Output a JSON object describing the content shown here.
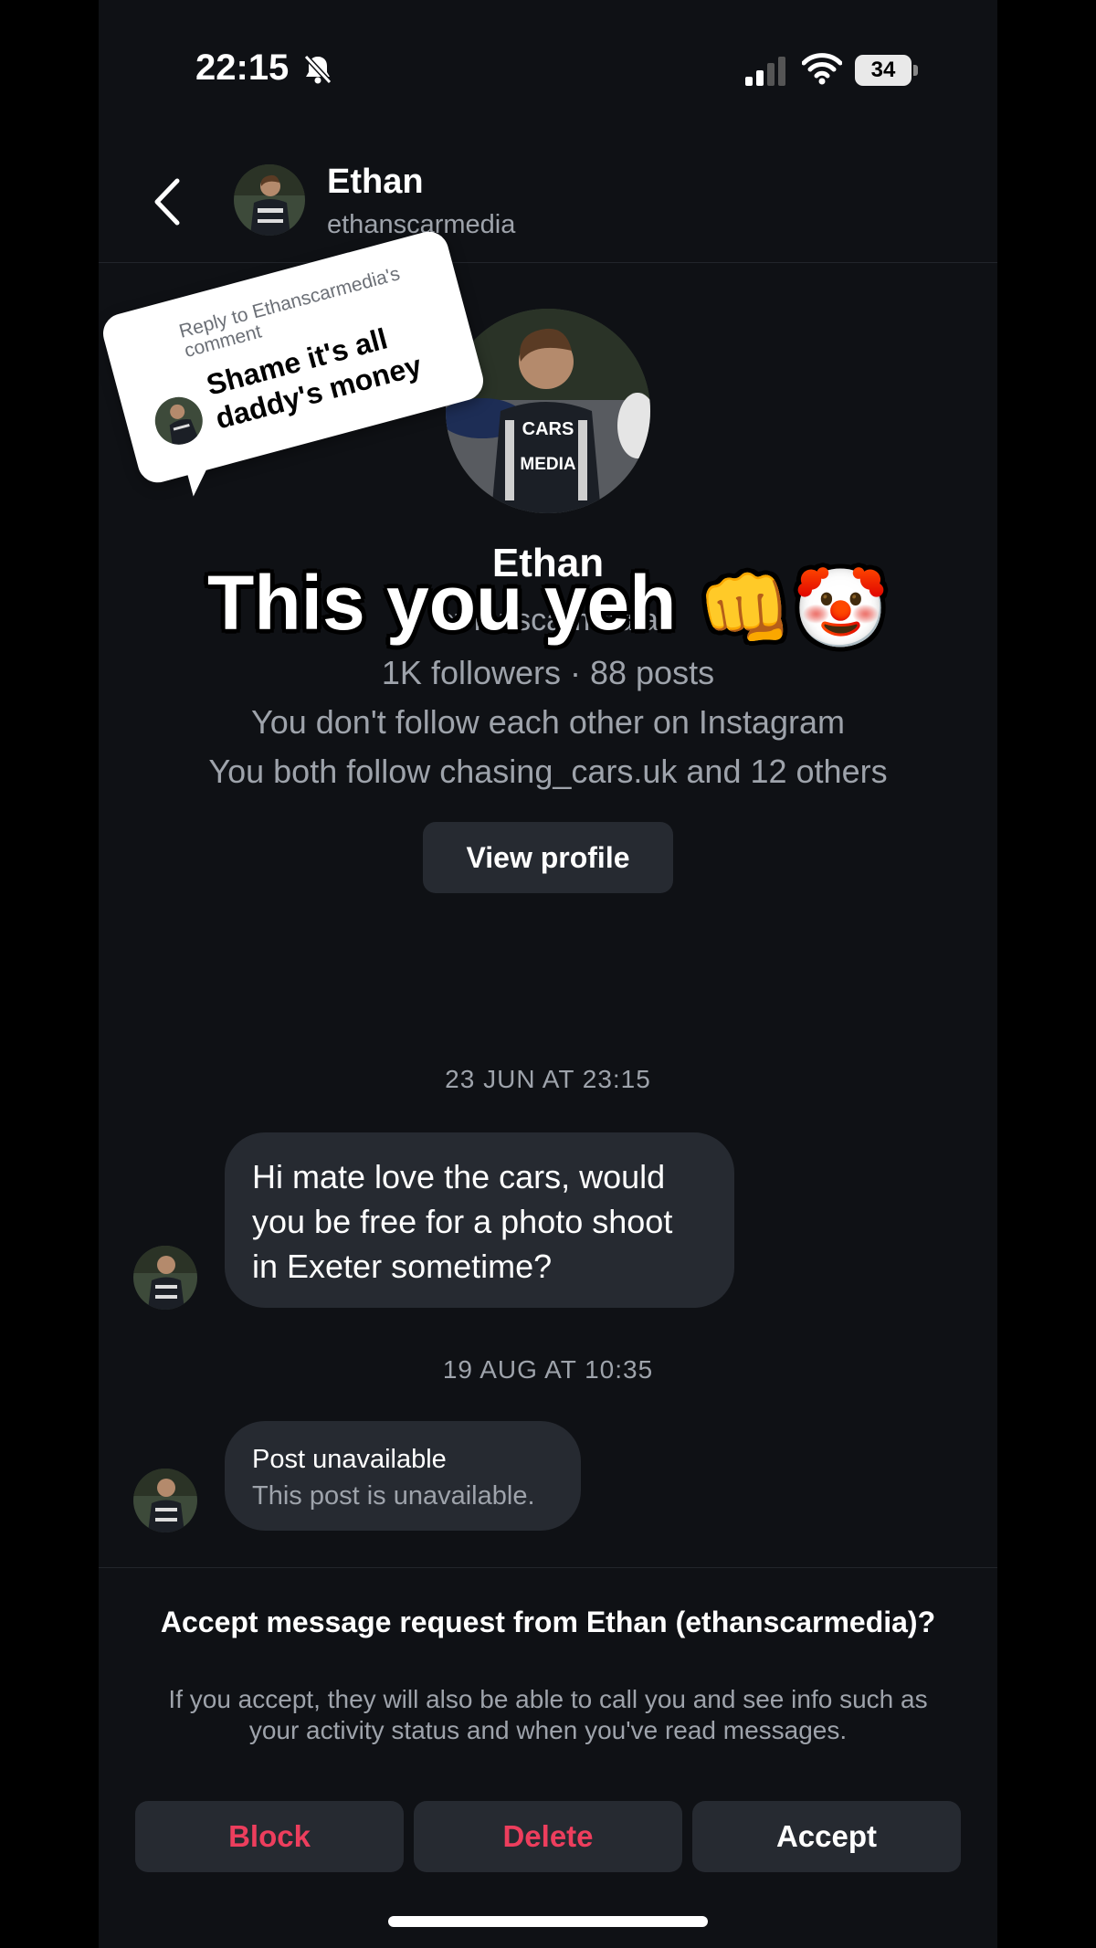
{
  "status_bar": {
    "time": "22:15",
    "battery": "34",
    "icons": [
      "bell-slash-icon",
      "signal-icon",
      "wifi-icon",
      "battery-icon"
    ]
  },
  "header": {
    "name": "Ethan",
    "username": "ethanscarmedia",
    "back_icon": "chevron-left-icon"
  },
  "profile": {
    "name": "Ethan",
    "username": "ethanscarmedia",
    "stats": "1K followers · 88 posts",
    "follow_status": "You don't follow each other on Instagram",
    "mutual": "You both follow chasing_cars.uk and 12 others",
    "view_profile": "View profile"
  },
  "overlay": {
    "caption": "This you yeh",
    "emojis": "👊🤡",
    "reply_meta": "Reply to Ethanscarmedia's comment",
    "reply_text": "Shame it's all daddy's money"
  },
  "messages": [
    {
      "timestamp": "23 JUN AT 23:15",
      "text": "Hi mate love the cars, would you be free for a photo shoot in Exeter sometime?"
    },
    {
      "timestamp": "19 AUG AT 10:35",
      "title": "Post unavailable",
      "subtitle": "This post is unavailable."
    }
  ],
  "request": {
    "title": "Accept message request from Ethan (ethanscarmedia)?",
    "body": "If you accept, they will also be able to call you and see info such as your activity status and when you've read messages.",
    "block": "Block",
    "delete": "Delete",
    "accept": "Accept"
  },
  "colors": {
    "background": "#0f1115",
    "bubble": "#262a31",
    "danger": "#ed3e5d",
    "muted": "#9ea3ab"
  }
}
